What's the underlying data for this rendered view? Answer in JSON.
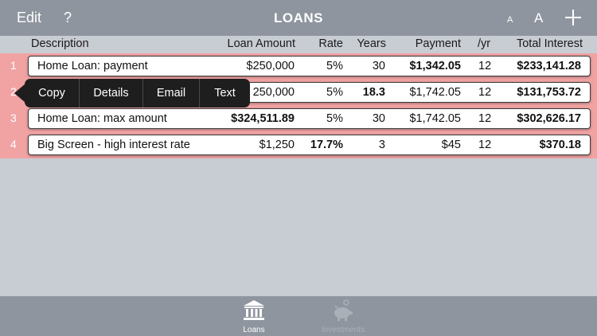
{
  "nav": {
    "edit_label": "Edit",
    "help_label": "?",
    "title": "LOANS",
    "font_small_label": "A",
    "font_large_label": "A",
    "add_icon": "plus-icon"
  },
  "columns": {
    "description": "Description",
    "loan_amount": "Loan Amount",
    "rate": "Rate",
    "years": "Years",
    "payment": "Payment",
    "per_year": "/yr",
    "total_interest": "Total Interest"
  },
  "colors": {
    "bar": "#8e959f",
    "background": "#c8ccd3",
    "row_highlight": "#f1a3a3",
    "menu": "#1e1e1e"
  },
  "rows": [
    {
      "num": "1",
      "description": "Home Loan: payment",
      "amount": "$250,000",
      "rate": "5%",
      "years": "30",
      "payment": "$1,342.05",
      "per_year": "12",
      "interest": "$233,141.28"
    },
    {
      "num": "2",
      "description": "",
      "amount": "250,000",
      "rate": "5%",
      "years": "18.3",
      "payment": "$1,742.05",
      "per_year": "12",
      "interest": "$131,753.72"
    },
    {
      "num": "3",
      "description": "Home Loan: max amount",
      "amount": "$324,511.89",
      "rate": "5%",
      "years": "30",
      "payment": "$1,742.05",
      "per_year": "12",
      "interest": "$302,626.17"
    },
    {
      "num": "4",
      "description": "Big Screen - high interest rate",
      "amount": "$1,250",
      "rate": "17.7%",
      "years": "3",
      "payment": "$45",
      "per_year": "12",
      "interest": "$370.18"
    }
  ],
  "context_menu": {
    "items": [
      "Copy",
      "Details",
      "Email",
      "Text"
    ]
  },
  "tabs": [
    {
      "label": "Loans",
      "icon": "bank-icon",
      "selected": true
    },
    {
      "label": "Investments",
      "icon": "piggy-bank-icon",
      "selected": false
    }
  ]
}
